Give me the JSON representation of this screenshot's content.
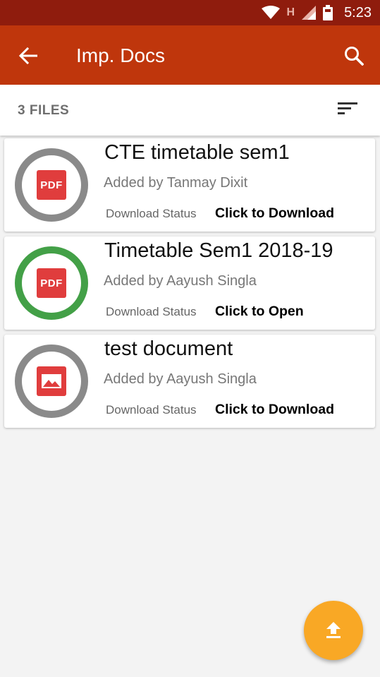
{
  "status_bar": {
    "time": "5:23",
    "network_label": "H",
    "icons": [
      "wifi-icon",
      "signal-icon",
      "battery-icon"
    ]
  },
  "app_bar": {
    "title": "Imp. Docs",
    "back_icon": "back-arrow-icon",
    "search_icon": "search-icon",
    "color": "#bf360c"
  },
  "files_bar": {
    "count_label": "3 FILES",
    "sort_icon": "sort-icon"
  },
  "files": [
    {
      "name": "CTE timetable sem1",
      "added_by": "Added by Tanmay Dixit",
      "status_label": "Download Status",
      "action": "Click to Download",
      "icon": "pdf-icon",
      "icon_text": "PDF",
      "ring_color": "#8a8a8a"
    },
    {
      "name": "Timetable Sem1 2018-19",
      "added_by": "Added by Aayush Singla",
      "status_label": "Download Status",
      "action": "Click to Open",
      "icon": "pdf-icon",
      "icon_text": "PDF",
      "ring_color": "#43a047"
    },
    {
      "name": "test document",
      "added_by": "Added by Aayush Singla",
      "status_label": "Download Status",
      "action": "Click to Download",
      "icon": "image-icon",
      "ring_color": "#8a8a8a"
    }
  ],
  "fab": {
    "icon": "upload-icon",
    "color": "#f9a825"
  }
}
